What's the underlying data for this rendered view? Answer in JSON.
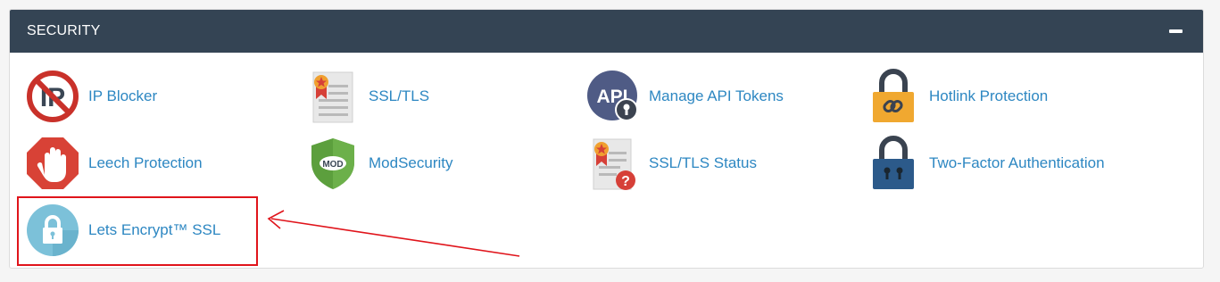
{
  "section": {
    "title": "SECURITY",
    "collapse_icon": "minus-icon"
  },
  "items": [
    {
      "label": "IP Blocker",
      "icon": "ip-blocker-icon"
    },
    {
      "label": "SSL/TLS",
      "icon": "ssl-certificate-icon"
    },
    {
      "label": "Manage API Tokens",
      "icon": "api-tokens-icon"
    },
    {
      "label": "Hotlink Protection",
      "icon": "hotlink-lock-icon"
    },
    {
      "label": "Leech Protection",
      "icon": "stop-hand-icon"
    },
    {
      "label": "ModSecurity",
      "icon": "mod-shield-icon"
    },
    {
      "label": "SSL/TLS Status",
      "icon": "ssl-status-icon"
    },
    {
      "label": "Two-Factor Authentication",
      "icon": "two-factor-lock-icon"
    },
    {
      "label": "Lets Encrypt™ SSL",
      "icon": "lets-encrypt-lock-icon"
    }
  ],
  "colors": {
    "header": "#344454",
    "link": "#2d87c2",
    "annotation": "#e0141b"
  }
}
